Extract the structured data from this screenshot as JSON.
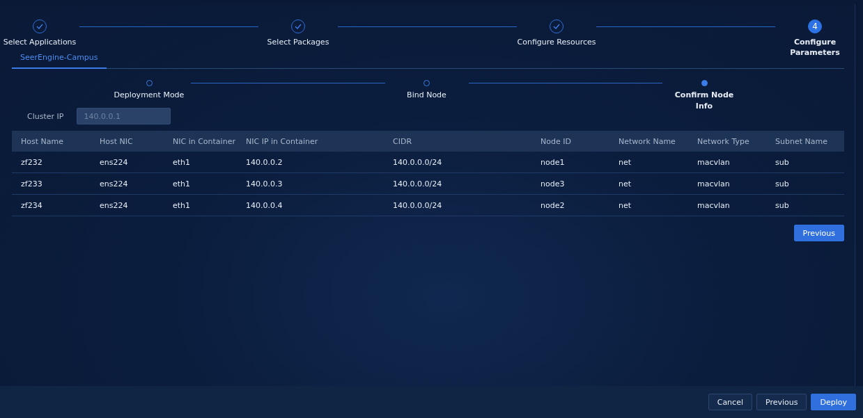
{
  "steps": [
    {
      "label": "Select Applications",
      "done": true
    },
    {
      "label": "Select Packages",
      "done": true
    },
    {
      "label": "Configure Resources",
      "done": true
    },
    {
      "label": "Configure Parameters",
      "done": false,
      "number": "4"
    }
  ],
  "tabs": [
    {
      "label": "SeerEngine-Campus",
      "selected": true
    }
  ],
  "sub_steps": [
    {
      "label": "Deployment Mode",
      "current": false
    },
    {
      "label": "Bind Node",
      "current": false
    },
    {
      "label": "Confirm Node Info",
      "current": true
    }
  ],
  "cluster_ip": {
    "label": "Cluster IP",
    "value": "140.0.0.1",
    "disabled": true
  },
  "table": {
    "columns": [
      "Host Name",
      "Host NIC",
      "NIC in Container",
      "NIC IP in Container",
      "CIDR",
      "Node ID",
      "Network Name",
      "Network Type",
      "Subnet Name"
    ],
    "rows": [
      [
        "zf232",
        "ens224",
        "eth1",
        "140.0.0.2",
        "140.0.0.0/24",
        "node1",
        "net",
        "macvlan",
        "sub"
      ],
      [
        "zf233",
        "ens224",
        "eth1",
        "140.0.0.3",
        "140.0.0.0/24",
        "node3",
        "net",
        "macvlan",
        "sub"
      ],
      [
        "zf234",
        "ens224",
        "eth1",
        "140.0.0.4",
        "140.0.0.0/24",
        "node2",
        "net",
        "macvlan",
        "sub"
      ]
    ]
  },
  "panel_button": "Previous",
  "footer_buttons": [
    {
      "label": "Cancel",
      "kind": "secondary"
    },
    {
      "label": "Previous",
      "kind": "secondary"
    },
    {
      "label": "Deploy",
      "kind": "primary"
    }
  ]
}
